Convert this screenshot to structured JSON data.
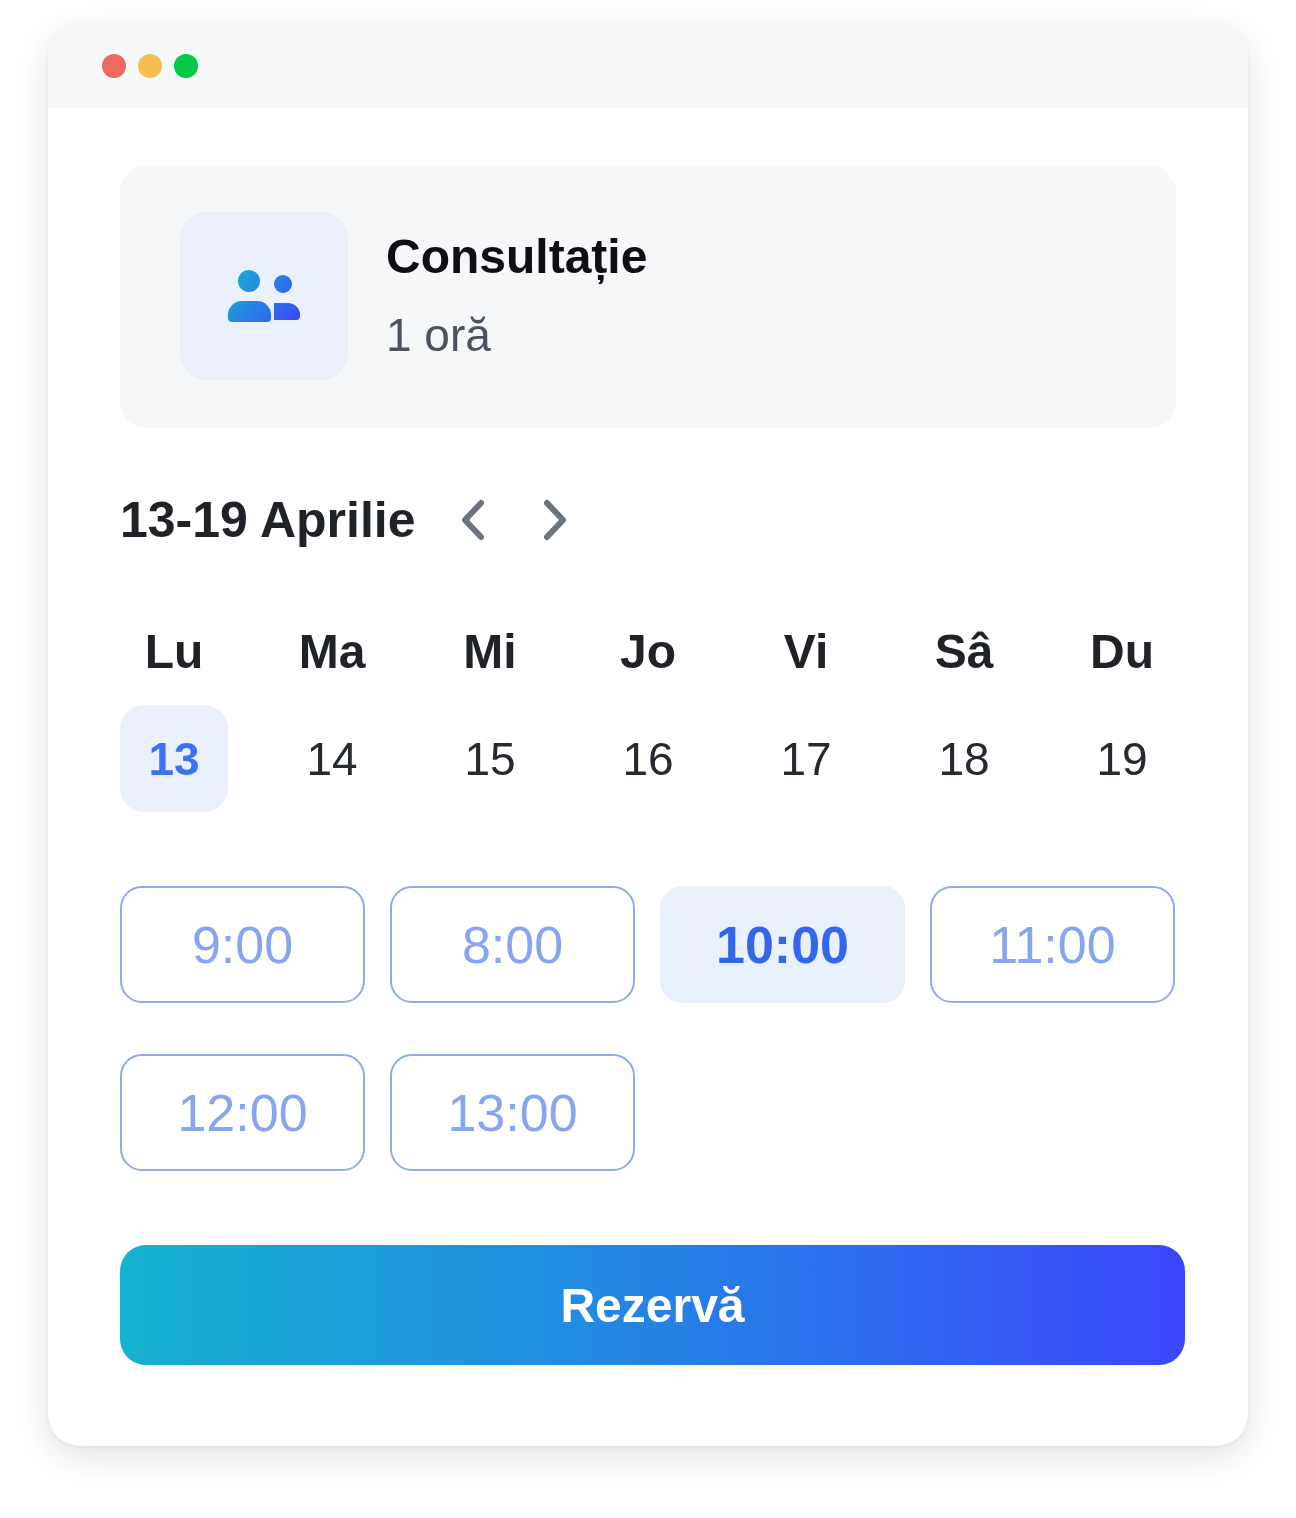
{
  "window_controls": [
    {
      "color": "#ec6a5e"
    },
    {
      "color": "#f4bf4f"
    },
    {
      "color": "#05c846"
    }
  ],
  "service": {
    "title": "Consultație",
    "duration": "1 oră"
  },
  "week": {
    "label": "13-19 Aprilie"
  },
  "days": [
    {
      "weekday": "Lu",
      "date": "13",
      "selected": true
    },
    {
      "weekday": "Ma",
      "date": "14",
      "selected": false
    },
    {
      "weekday": "Mi",
      "date": "15",
      "selected": false
    },
    {
      "weekday": "Jo",
      "date": "16",
      "selected": false
    },
    {
      "weekday": "Vi",
      "date": "17",
      "selected": false
    },
    {
      "weekday": "Sâ",
      "date": "18",
      "selected": false
    },
    {
      "weekday": "Du",
      "date": "19",
      "selected": false
    }
  ],
  "time_slots": [
    {
      "time": "9:00",
      "selected": false
    },
    {
      "time": "8:00",
      "selected": false
    },
    {
      "time": "10:00",
      "selected": true
    },
    {
      "time": "11:00",
      "selected": false
    },
    {
      "time": "12:00",
      "selected": false
    },
    {
      "time": "13:00",
      "selected": false
    }
  ],
  "book_button": {
    "label": "Rezervă"
  }
}
